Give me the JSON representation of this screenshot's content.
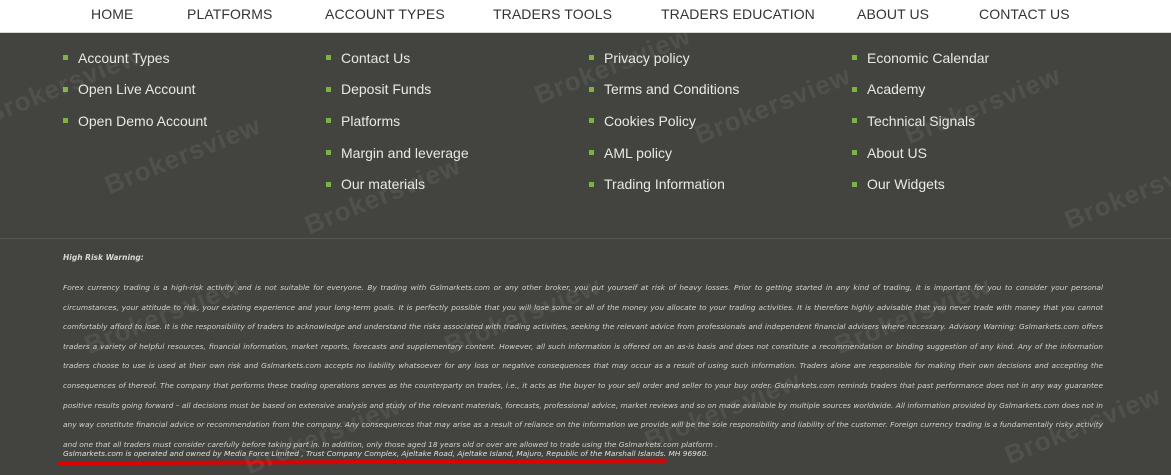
{
  "nav": {
    "items": [
      "HOME",
      "PLATFORMS",
      "ACCOUNT TYPES",
      "TRADERS TOOLS",
      "TRADERS EDUCATION",
      "ABOUT US",
      "CONTACT US"
    ]
  },
  "footer": {
    "columns": [
      [
        "Account Types",
        "Open Live Account",
        "Open Demo Account"
      ],
      [
        "Contact Us",
        "Deposit Funds",
        "Platforms",
        "Margin and leverage",
        "Our materials"
      ],
      [
        "Privacy policy",
        "Terms and Conditions",
        "Cookies Policy",
        "AML policy",
        "Trading Information"
      ],
      [
        "Economic Calendar",
        "Academy",
        "Technical Signals",
        "About US",
        "Our Widgets"
      ]
    ]
  },
  "legal": {
    "title": "High Risk Warning:",
    "text": "Forex currency trading is a high-risk activity and is not suitable for everyone. By trading with Gslmarkets.com or any other broker, you put yourself at risk of heavy losses. Prior to getting started in any kind of trading, it is important for you to consider your personal circumstances, your attitude to risk, your existing experience and your long-term goals. It is perfectly possible that you will lose some or all of the money you allocate to your trading activities. It is therefore highly advisable that you never trade with money that you cannot comfortably afford to lose. It is the responsibility of traders to acknowledge and understand the risks associated with trading activities, seeking the relevant advice from professionals and independent financial advisers where necessary. Advisory Warning: Gslmarkets.com offers traders a variety of helpful resources, financial information, market reports, forecasts and supplementary content. However, all such information is offered on an as-is basis and does not constitute a recommendation or binding suggestion of any kind. Any of the information traders choose to use is used at their own risk and Gslmarkets.com accepts no liability whatsoever for any loss or negative consequences that may occur as a result of using such information. Traders alone are responsible for making their own decisions and accepting the consequences of thereof. The company that performs these trading operations serves as the counterparty on trades, i.e., it acts as the buyer to your sell order and seller to your buy order. Gslmarkets.com reminds traders that past performance does not in any way guarantee positive results going forward – all decisions must be based on extensive analysis and study of the relevant materials, forecasts, professional advice, market reviews and so on made available by multiple sources worldwide. All information provided by Gslmarkets.com does not in any way constitute financial advice or recommendation from the company. Any consequences that may arise as a result of reliance on the information we provide will be the sole responsibility and liability of the customer. Foreign currency trading is a fundamentally risky activity and one that all traders must consider carefully before taking part in. In addition, only those aged 18 years old or over are allowed to trade using the Gslmarkets.com platform .",
    "ownership": "Gslmarkets.com is operated and owned by  Media Force Limited , Trust Company Complex, Ajeltake Road, Ajeltake Island, Majuro, Republic of the Marshall Islands. MH 96960."
  },
  "watermark": "Brokersview",
  "colors": {
    "bullet": "#7cb342",
    "footer_bg": "#434340",
    "underline": "#e00000"
  }
}
